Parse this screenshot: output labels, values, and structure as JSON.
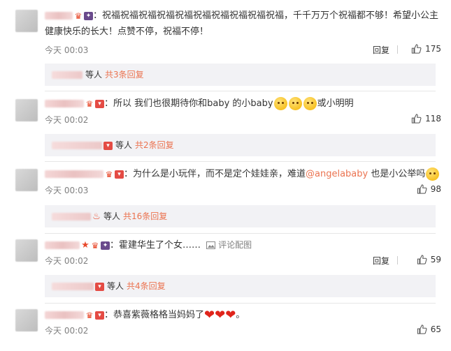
{
  "comments": [
    {
      "text": "：祝福祝福祝福祝福祝福祝福祝福祝福祝福祝福，千千万万个祝福都不够！希望小公主健康快乐的长大！点赞不停，祝福不停！",
      "time": "今天 00:03",
      "reply": "回复",
      "likes": "175",
      "sub": {
        "deng": "等人",
        "more": "共3条回复"
      }
    },
    {
      "text_a": "：所以 我们也很期待你和baby 的小baby",
      "text_b": "或小明明",
      "time": "今天 00:02",
      "likes": "118",
      "sub": {
        "deng": "等人",
        "more": "共2条回复"
      }
    },
    {
      "text_a": "：为什么是小玩伴，而不是定个娃娃亲，难道",
      "mention": "@angelababy",
      "text_b": " 也是小公举吗",
      "time": "今天 00:03",
      "likes": "98",
      "sub": {
        "deng": "等人",
        "more": "共16条回复"
      }
    },
    {
      "text": "：霍建华生了个女……",
      "pic_link": "评论配图",
      "time": "今天 00:02",
      "reply": "回复",
      "likes": "59",
      "sub": {
        "deng": "等人",
        "more": "共4条回复"
      }
    },
    {
      "text_a": "：恭喜紫薇格格当妈妈了",
      "text_b": "。",
      "time": "今天 00:02",
      "likes": "65"
    }
  ],
  "icons": {
    "thumb": "thumbs-up-icon",
    "image": "image-icon",
    "emoji": "smiley-emoji-icon",
    "heart": "heart-emoji-icon"
  },
  "colors": {
    "accent": "#eb7350",
    "subbg": "#f2f2f5",
    "meta": "#808080"
  }
}
